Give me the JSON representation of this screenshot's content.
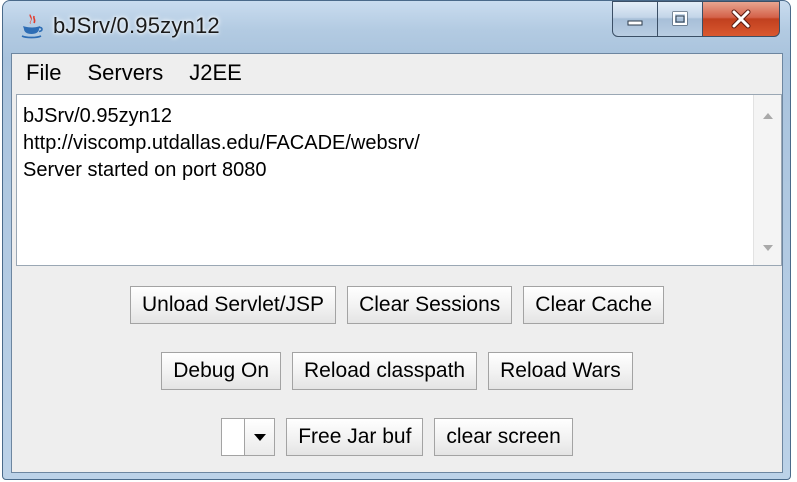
{
  "window": {
    "title": "bJSrv/0.95zyn12",
    "app_icon": "java-coffee-icon"
  },
  "caption_buttons": {
    "minimize_icon": "minimize-icon",
    "maximize_icon": "maximize-icon",
    "close_icon": "close-icon"
  },
  "menu": {
    "items": [
      {
        "label": "File"
      },
      {
        "label": "Servers"
      },
      {
        "label": "J2EE"
      }
    ]
  },
  "log": {
    "lines": [
      "bJSrv/0.95zyn12",
      "http://viscomp.utdallas.edu/FACADE/websrv/",
      "Server started on port 8080"
    ]
  },
  "buttons": {
    "row1": [
      "Unload Servlet/JSP",
      "Clear Sessions",
      "Clear Cache"
    ],
    "row2": [
      "Debug On",
      "Reload classpath",
      "Reload Wars"
    ],
    "row3": [
      "Free Jar buf",
      "clear screen"
    ]
  },
  "combo": {
    "value": ""
  },
  "colors": {
    "close_button": "#c1401f",
    "frame": "#a9c3dd",
    "client_bg": "#eeeeee"
  }
}
